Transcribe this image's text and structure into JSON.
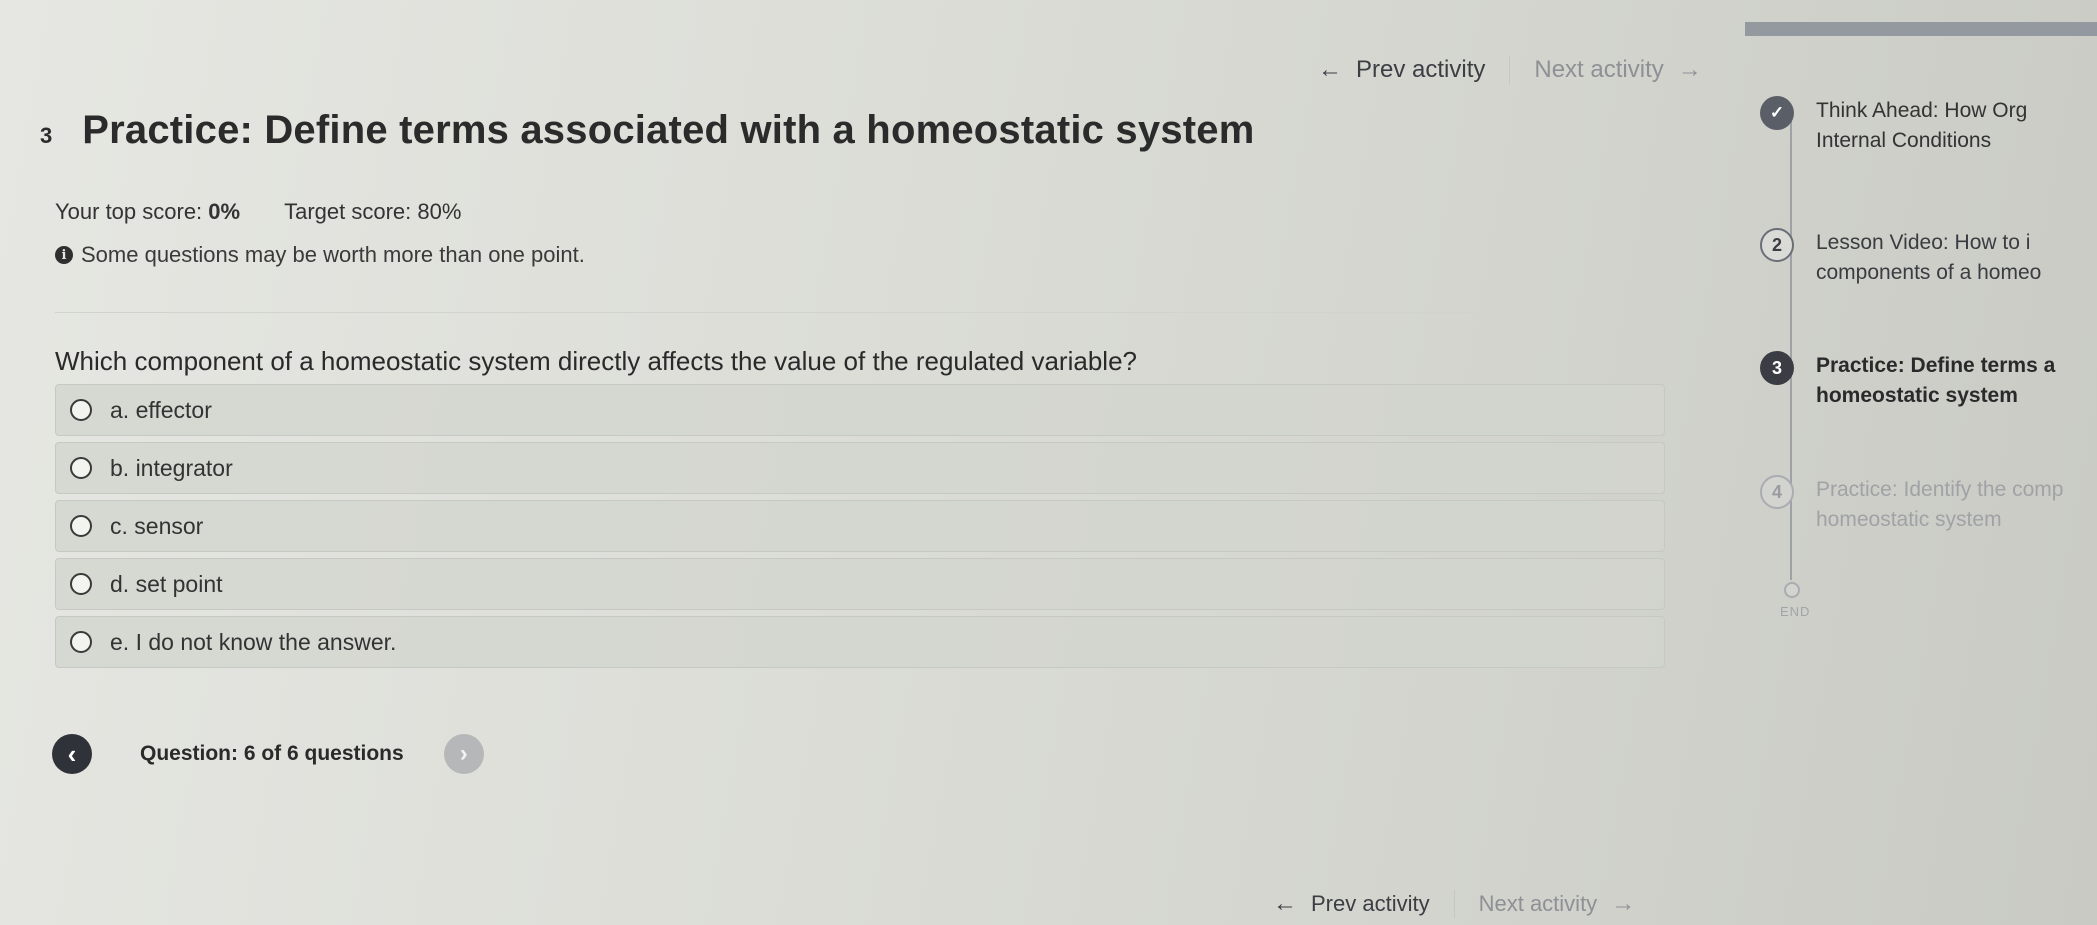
{
  "top_nav": {
    "prev": "Prev activity",
    "next": "Next activity"
  },
  "activity": {
    "number": "3",
    "title": "Practice: Define terms associated with a homeostatic system",
    "top_score_label": "Your top score:",
    "top_score_value": "0%",
    "target_score_label": "Target score:",
    "target_score_value": "80%",
    "note": "Some questions may be worth more than one point."
  },
  "question": {
    "prompt": "Which component of a homeostatic system directly affects the value of the regulated variable?",
    "options": [
      {
        "label": "a. effector"
      },
      {
        "label": "b. integrator"
      },
      {
        "label": "c. sensor"
      },
      {
        "label": "d. set point"
      },
      {
        "label": "e. I do not know the answer."
      }
    ],
    "progress_label": "Question: 6 of 6 questions"
  },
  "bottom_nav": {
    "prev": "Prev activity",
    "next": "Next activity"
  },
  "sidebar": {
    "steps": [
      {
        "marker": "✓",
        "line1": "Think Ahead: How Org",
        "line2": "Internal Conditions",
        "state": "done"
      },
      {
        "marker": "2",
        "line1": "Lesson Video: How to i",
        "line2": "components of a homeo",
        "state": "visited"
      },
      {
        "marker": "3",
        "line1": "Practice: Define terms a",
        "line2": "homeostatic system",
        "state": "current"
      },
      {
        "marker": "4",
        "line1": "Practice: Identify the comp",
        "line2": "homeostatic system",
        "state": "upcoming"
      }
    ],
    "end_label": "END"
  }
}
